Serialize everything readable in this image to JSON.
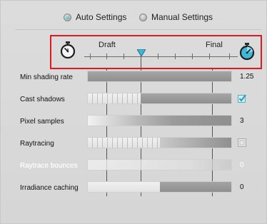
{
  "modes": {
    "auto_label": "Auto Settings",
    "manual_label": "Manual Settings",
    "selected": "auto"
  },
  "quality": {
    "left_label": "Draft",
    "right_label": "Final",
    "position": 0.36,
    "highlight_color": "#e0191e",
    "thumb_color": "#3fb7d9"
  },
  "rows": [
    {
      "label": "Min shading rate",
      "value": "1.25",
      "enabled": true,
      "level": 1.0
    },
    {
      "label": "Cast shadows",
      "value_type": "checkbox",
      "checked": true,
      "enabled": true,
      "level": 0.6
    },
    {
      "label": "Pixel samples",
      "value": "3",
      "enabled": true,
      "level": 1.0
    },
    {
      "label": "Raytracing",
      "value_type": "checkbox",
      "checked": false,
      "enabled": true,
      "level": 0.5
    },
    {
      "label": "Raytrace bounces",
      "value": "0",
      "enabled": false,
      "level": 0.05
    },
    {
      "label": "Irradiance caching",
      "value": "0",
      "enabled": true,
      "level": 0.5
    }
  ],
  "colors": {
    "panel_bg": "#d9d9d9",
    "bar_fill": "#9a9a9a",
    "check_color": "#3fb7d9"
  }
}
